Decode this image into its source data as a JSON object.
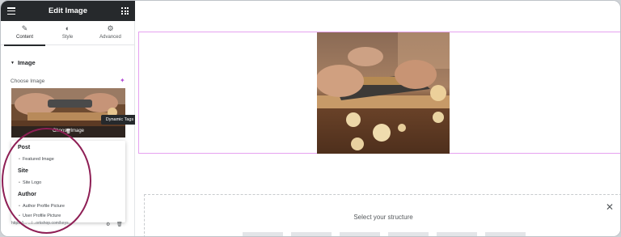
{
  "header": {
    "title": "Edit Image",
    "menu_icon": "hamburger-icon",
    "apps_icon": "grid-icon"
  },
  "tabs": [
    {
      "label": "Content",
      "icon": "pencil-icon",
      "active": true
    },
    {
      "label": "Style",
      "icon": "half-circle-icon",
      "active": false
    },
    {
      "label": "Advanced",
      "icon": "gear-icon",
      "active": false
    }
  ],
  "section": {
    "title": "Image"
  },
  "image_control": {
    "label": "Choose Image",
    "thumb_label": "Choose Image",
    "dynamic_icon": "dynamic-tags-icon"
  },
  "tooltip": {
    "text": "Dynamic Tags"
  },
  "dropdown": {
    "groups": [
      {
        "label": "Post",
        "items": [
          "Featured Image"
        ]
      },
      {
        "label": "Site",
        "items": [
          "Site Logo"
        ]
      },
      {
        "label": "Author",
        "items": [
          "Author Profile Picture",
          "User Profile Picture"
        ]
      }
    ]
  },
  "url_field": {
    "value": "https://... .../...orkshop.com/keys..."
  },
  "structure_panel": {
    "title": "Select your structure"
  },
  "colors": {
    "header_bg": "#26292c",
    "accent": "#b44fd6",
    "annotation": "#8e1f55",
    "outline": "#e6a1f0"
  }
}
